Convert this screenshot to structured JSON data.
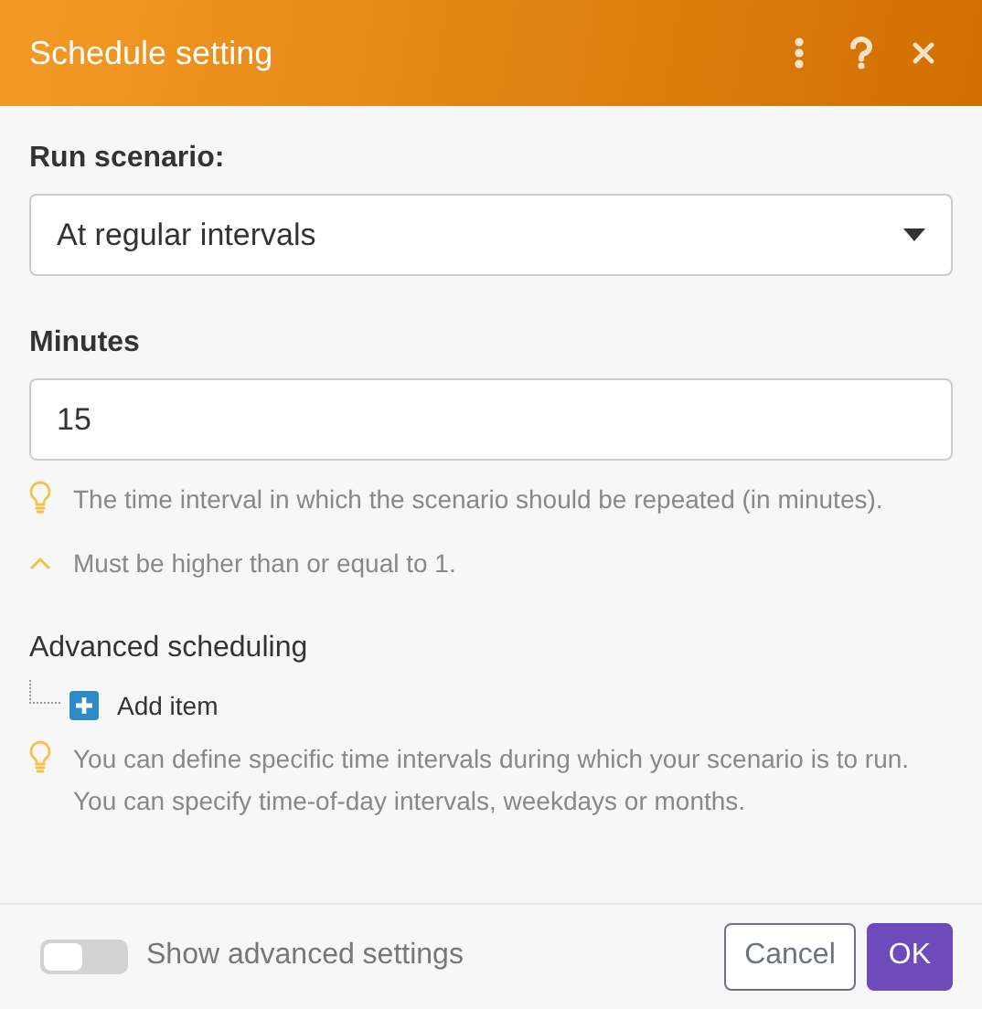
{
  "window": {
    "title": "Schedule setting"
  },
  "header_buttons": [
    {
      "kind": "more"
    },
    {
      "kind": "help"
    },
    {
      "kind": "close"
    }
  ],
  "run_scenario": {
    "label": "Run scenario:",
    "value": "At regular intervals"
  },
  "minutes": {
    "label": "Minutes",
    "value": "15",
    "hint": "The time interval in which the scenario should be repeated (in minutes).",
    "validation": "Must be higher than or equal to 1."
  },
  "advanced_scheduling": {
    "label": "Advanced scheduling",
    "add_item": "Add item",
    "hint": "You can define specific time intervals during which your scenario is to run. You can specify time-of-day intervals, weekdays or months."
  },
  "footer": {
    "toggle": {
      "label": "Show advanced settings",
      "on": false
    },
    "buttons": [
      {
        "label": "Cancel",
        "kind": "secondary"
      },
      {
        "label": "OK",
        "kind": "primary"
      }
    ]
  }
}
